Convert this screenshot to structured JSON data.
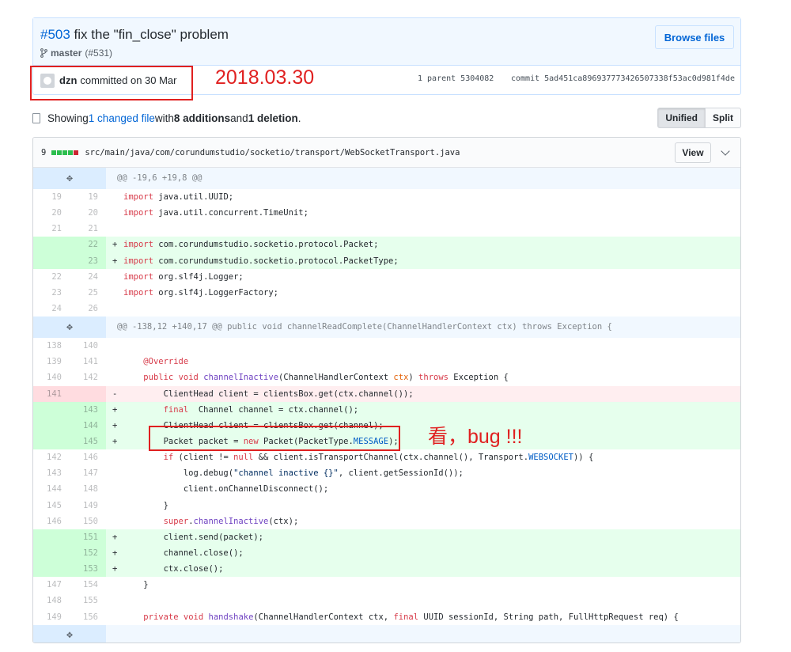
{
  "commit": {
    "number": "#503",
    "title": " fix the \"fin_close\" problem",
    "branch_icon": "git-branch-icon",
    "branch": "master",
    "branch_ref": "(#531)",
    "browse_label": "Browse files",
    "author": "dzn",
    "committed_text": "committed on 30 Mar",
    "parent_label": "1 parent 5304082",
    "commit_label": "commit 5ad451ca896937773426507338f53ac0d981f4de"
  },
  "annotations": {
    "date_note": "2018.03.30",
    "bug_note": "看，bug !!!"
  },
  "toc": {
    "showing": "Showing ",
    "changed_files": "1 changed file",
    "with": " with ",
    "additions": "8 additions",
    "and": " and ",
    "deletions": "1 deletion",
    "period": ".",
    "unified_label": "Unified",
    "split_label": "Split"
  },
  "file": {
    "changes": "9",
    "diffstat": [
      "add",
      "add",
      "add",
      "add",
      "del"
    ],
    "path": "src/main/java/com/corundumstudio/socketio/transport/WebSocketTransport.java",
    "view_label": "View"
  },
  "diff_lines": [
    {
      "type": "hunk",
      "text": "@@ -19,6 +19,8 @@"
    },
    {
      "type": "ctx",
      "old": "19",
      "new": "19",
      "text": "import java.util.UUID;"
    },
    {
      "type": "ctx",
      "old": "20",
      "new": "20",
      "text": "import java.util.concurrent.TimeUnit;"
    },
    {
      "type": "ctx",
      "old": "21",
      "new": "21",
      "text": ""
    },
    {
      "type": "add",
      "old": "",
      "new": "22",
      "text": "import com.corundumstudio.socketio.protocol.Packet;"
    },
    {
      "type": "add",
      "old": "",
      "new": "23",
      "text": "import com.corundumstudio.socketio.protocol.PacketType;"
    },
    {
      "type": "ctx",
      "old": "22",
      "new": "24",
      "text": "import org.slf4j.Logger;"
    },
    {
      "type": "ctx",
      "old": "23",
      "new": "25",
      "text": "import org.slf4j.LoggerFactory;"
    },
    {
      "type": "ctx",
      "old": "24",
      "new": "26",
      "text": ""
    },
    {
      "type": "hunk",
      "text": "@@ -138,12 +140,17 @@ public void channelReadComplete(ChannelHandlerContext ctx) throws Exception {"
    },
    {
      "type": "ctx",
      "old": "138",
      "new": "140",
      "text": ""
    },
    {
      "type": "ctx",
      "old": "139",
      "new": "141",
      "text": "    @Override"
    },
    {
      "type": "ctx",
      "old": "140",
      "new": "142",
      "text": "    public void channelInactive(ChannelHandlerContext ctx) throws Exception {"
    },
    {
      "type": "del",
      "old": "141",
      "new": "",
      "text": "        ClientHead client = clientsBox.get(ctx.channel());"
    },
    {
      "type": "add",
      "old": "",
      "new": "143",
      "text": "        final  Channel channel = ctx.channel();"
    },
    {
      "type": "add",
      "old": "",
      "new": "144",
      "text": "        ClientHead client = clientsBox.get(channel);"
    },
    {
      "type": "add",
      "old": "",
      "new": "145",
      "text": "        Packet packet = new Packet(PacketType.MESSAGE);"
    },
    {
      "type": "ctx",
      "old": "142",
      "new": "146",
      "text": "        if (client != null && client.isTransportChannel(ctx.channel(), Transport.WEBSOCKET)) {"
    },
    {
      "type": "ctx",
      "old": "143",
      "new": "147",
      "text": "            log.debug(\"channel inactive {}\", client.getSessionId());"
    },
    {
      "type": "ctx",
      "old": "144",
      "new": "148",
      "text": "            client.onChannelDisconnect();"
    },
    {
      "type": "ctx",
      "old": "145",
      "new": "149",
      "text": "        }"
    },
    {
      "type": "ctx",
      "old": "146",
      "new": "150",
      "text": "        super.channelInactive(ctx);"
    },
    {
      "type": "add",
      "old": "",
      "new": "151",
      "text": "        client.send(packet);"
    },
    {
      "type": "add",
      "old": "",
      "new": "152",
      "text": "        channel.close();"
    },
    {
      "type": "add",
      "old": "",
      "new": "153",
      "text": "        ctx.close();"
    },
    {
      "type": "ctx",
      "old": "147",
      "new": "154",
      "text": "    }"
    },
    {
      "type": "ctx",
      "old": "148",
      "new": "155",
      "text": ""
    },
    {
      "type": "ctx",
      "old": "149",
      "new": "156",
      "text": "    private void handshake(ChannelHandlerContext ctx, final UUID sessionId, String path, FullHttpRequest req) {"
    },
    {
      "type": "hunk",
      "text": ""
    }
  ]
}
